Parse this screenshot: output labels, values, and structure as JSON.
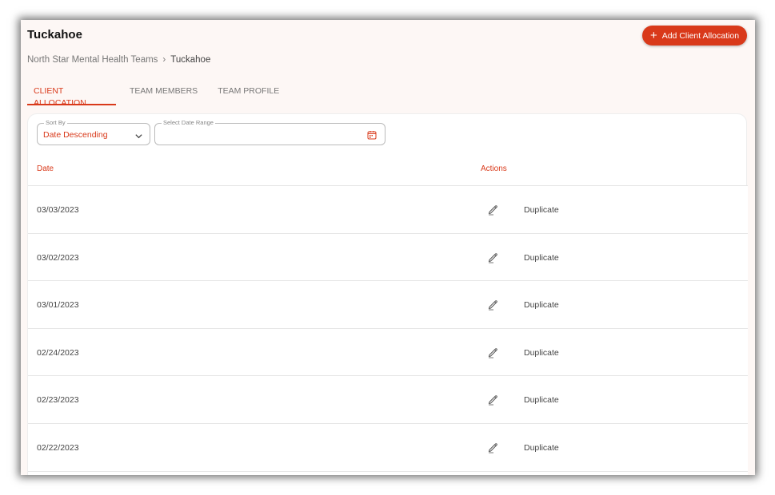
{
  "page": {
    "title": "Tuckahoe",
    "add_button_label": "Add Client Allocation"
  },
  "breadcrumb": {
    "parent": "North Star Mental Health Teams",
    "separator": "›",
    "current": "Tuckahoe"
  },
  "tabs": [
    {
      "label": "CLIENT ALLOCATION",
      "active": true
    },
    {
      "label": "TEAM MEMBERS",
      "active": false
    },
    {
      "label": "TEAM PROFILE",
      "active": false
    }
  ],
  "filters": {
    "sort_label": "Sort By",
    "sort_value": "Date Descending",
    "date_label": "Select Date Range",
    "date_value": ""
  },
  "table": {
    "headers": {
      "date": "Date",
      "actions": "Actions"
    },
    "rows": [
      {
        "date": "03/03/2023",
        "duplicate": "Duplicate"
      },
      {
        "date": "03/02/2023",
        "duplicate": "Duplicate"
      },
      {
        "date": "03/01/2023",
        "duplicate": "Duplicate"
      },
      {
        "date": "02/24/2023",
        "duplicate": "Duplicate"
      },
      {
        "date": "02/23/2023",
        "duplicate": "Duplicate"
      },
      {
        "date": "02/22/2023",
        "duplicate": "Duplicate"
      }
    ]
  },
  "icons": {
    "add": "plus-icon",
    "sort": "chevron-down-icon",
    "date": "calendar-icon",
    "edit": "pencil-icon"
  },
  "colors": {
    "accent": "#d9391a",
    "background": "#fdf7f5"
  }
}
